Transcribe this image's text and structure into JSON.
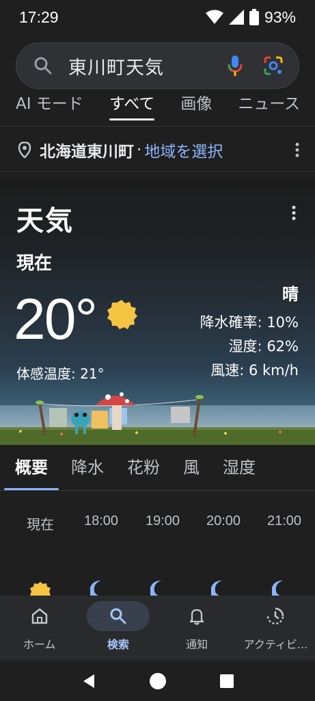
{
  "status": {
    "time": "17:29",
    "battery": "93%"
  },
  "search": {
    "query": "東川町天気"
  },
  "tabs": [
    {
      "label": "AI モード"
    },
    {
      "label": "すべて"
    },
    {
      "label": "画像"
    },
    {
      "label": "ニュース"
    }
  ],
  "location": {
    "name": "北海道東川町",
    "separator": "·",
    "change_label": "地域を選択"
  },
  "weather": {
    "title": "天気",
    "now_label": "現在",
    "temperature": "20°",
    "condition": "晴",
    "precipitation": "降水確率: 10%",
    "humidity": "湿度: 62%",
    "wind": "風速: 6 km/h",
    "feels_like": "体感温度: 21°"
  },
  "subtabs": [
    {
      "label": "概要"
    },
    {
      "label": "降水"
    },
    {
      "label": "花粉"
    },
    {
      "label": "風"
    },
    {
      "label": "湿度"
    }
  ],
  "hourly": [
    {
      "time": "現在",
      "icon": "sun-icon"
    },
    {
      "time": "18:00",
      "icon": "moon-icon"
    },
    {
      "time": "19:00",
      "icon": "moon-icon"
    },
    {
      "time": "20:00",
      "icon": "moon-icon"
    },
    {
      "time": "21:00",
      "icon": "moon-icon"
    }
  ],
  "bottom_nav": [
    {
      "label": "ホーム",
      "icon": "home-icon"
    },
    {
      "label": "検索",
      "icon": "search-icon"
    },
    {
      "label": "通知",
      "icon": "bell-icon"
    },
    {
      "label": "アクティビ...",
      "icon": "activity-icon"
    }
  ],
  "colors": {
    "link": "#8ab4f8",
    "sun": "#f6c443",
    "moon": "#8ab4f8",
    "active_nav": "#a8c7fa"
  }
}
